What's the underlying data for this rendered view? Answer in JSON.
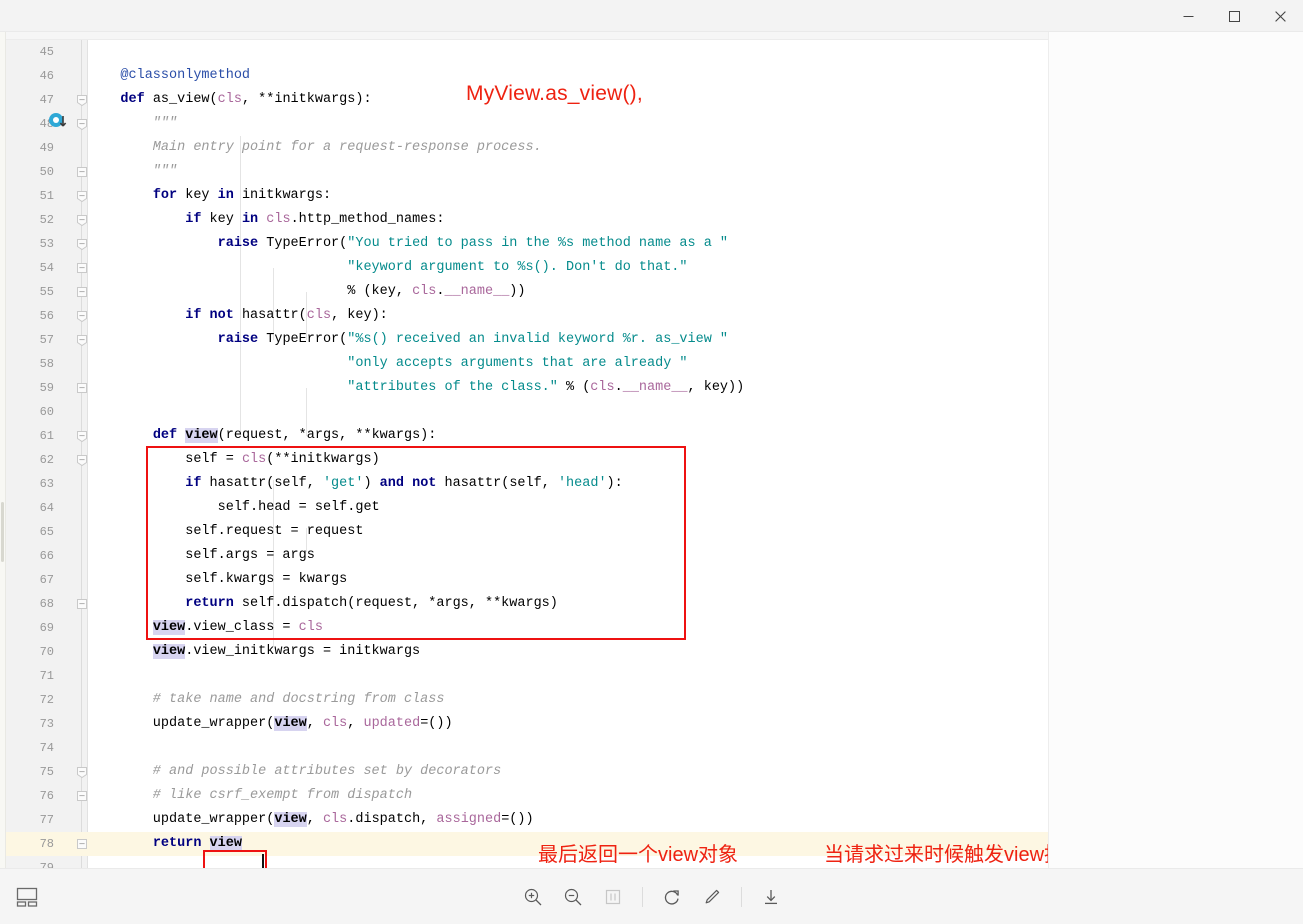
{
  "window": {
    "controls": [
      {
        "name": "minimize",
        "glyph": "minimize-icon",
        "label": "Minimize"
      },
      {
        "name": "maximize",
        "glyph": "maximize-icon",
        "label": "Maximize"
      },
      {
        "name": "close",
        "glyph": "close-icon",
        "label": "Close"
      }
    ]
  },
  "editor": {
    "language": "Python",
    "first_line_number": 45,
    "current_line_number": 78,
    "gutter_icon": "override-method-icon",
    "gutter_icon_line": 47,
    "line_numbers": [
      45,
      46,
      47,
      48,
      49,
      50,
      51,
      52,
      53,
      54,
      55,
      56,
      57,
      58,
      59,
      60,
      61,
      62,
      63,
      64,
      65,
      66,
      67,
      68,
      69,
      70,
      71,
      72,
      73,
      74,
      75,
      76,
      77,
      78,
      79
    ],
    "code_lines": [
      {
        "n": 45,
        "text": ""
      },
      {
        "n": 46,
        "text": "    @classonlymethod"
      },
      {
        "n": 47,
        "text": "    def as_view(cls, **initkwargs):"
      },
      {
        "n": 48,
        "text": "        \"\"\""
      },
      {
        "n": 49,
        "text": "        Main entry point for a request-response process."
      },
      {
        "n": 50,
        "text": "        \"\"\""
      },
      {
        "n": 51,
        "text": "        for key in initkwargs:"
      },
      {
        "n": 52,
        "text": "            if key in cls.http_method_names:"
      },
      {
        "n": 53,
        "text": "                raise TypeError(\"You tried to pass in the %s method name as a \""
      },
      {
        "n": 54,
        "text": "                                \"keyword argument to %s(). Don't do that.\""
      },
      {
        "n": 55,
        "text": "                                % (key, cls.__name__))"
      },
      {
        "n": 56,
        "text": "            if not hasattr(cls, key):"
      },
      {
        "n": 57,
        "text": "                raise TypeError(\"%s() received an invalid keyword %r. as_view \""
      },
      {
        "n": 58,
        "text": "                                \"only accepts arguments that are already \""
      },
      {
        "n": 59,
        "text": "                                \"attributes of the class.\" % (cls.__name__, key))"
      },
      {
        "n": 60,
        "text": ""
      },
      {
        "n": 61,
        "text": "        def view(request, *args, **kwargs):"
      },
      {
        "n": 62,
        "text": "            self = cls(**initkwargs)"
      },
      {
        "n": 63,
        "text": "            if hasattr(self, 'get') and not hasattr(self, 'head'):"
      },
      {
        "n": 64,
        "text": "                self.head = self.get"
      },
      {
        "n": 65,
        "text": "            self.request = request"
      },
      {
        "n": 66,
        "text": "            self.args = args"
      },
      {
        "n": 67,
        "text": "            self.kwargs = kwargs"
      },
      {
        "n": 68,
        "text": "            return self.dispatch(request, *args, **kwargs)"
      },
      {
        "n": 69,
        "text": "        view.view_class = cls"
      },
      {
        "n": 70,
        "text": "        view.view_initkwargs = initkwargs"
      },
      {
        "n": 71,
        "text": ""
      },
      {
        "n": 72,
        "text": "        # take name and docstring from class"
      },
      {
        "n": 73,
        "text": "        update_wrapper(view, cls, updated=())"
      },
      {
        "n": 74,
        "text": ""
      },
      {
        "n": 75,
        "text": "        # and possible attributes set by decorators"
      },
      {
        "n": 76,
        "text": "        # like csrf_exempt from dispatch"
      },
      {
        "n": 77,
        "text": "        update_wrapper(view, cls.dispatch, assigned=())"
      },
      {
        "n": 78,
        "text": "        return view"
      },
      {
        "n": 79,
        "text": ""
      }
    ]
  },
  "annotations": {
    "title": "MyView.as_view(),",
    "return_note": "最后返回一个view对象",
    "trigger_note": "当请求过来时候触发view执行该函数",
    "color": "#ee2211",
    "boxes": [
      {
        "name": "view-function-box",
        "target": "def view(...) body"
      },
      {
        "name": "return-view-box",
        "target": "return view"
      }
    ]
  },
  "toolbar": {
    "thumbnail_toggle": {
      "name": "thumbnail-panel-icon",
      "label": "Thumbnails"
    },
    "buttons": [
      {
        "name": "zoom-in-icon",
        "label": "Zoom in",
        "disabled": false
      },
      {
        "name": "zoom-out-icon",
        "label": "Zoom out",
        "disabled": false
      },
      {
        "name": "actual-size-icon",
        "label": "Actual size",
        "disabled": true
      },
      {
        "name": "rotate-icon",
        "label": "Rotate",
        "disabled": false
      },
      {
        "name": "edit-icon",
        "label": "Edit",
        "disabled": false
      },
      {
        "name": "download-icon",
        "label": "Save",
        "disabled": false
      }
    ]
  },
  "colors": {
    "keyword": "#000080",
    "string": "#058b8c",
    "comment": "#9a9a9a",
    "param": "#a9679b",
    "decorator": "#2b4ea8",
    "annotation_red": "#ee2211",
    "current_line": "#fdf7e3",
    "occurrence_highlight": "#d7d4f0"
  }
}
